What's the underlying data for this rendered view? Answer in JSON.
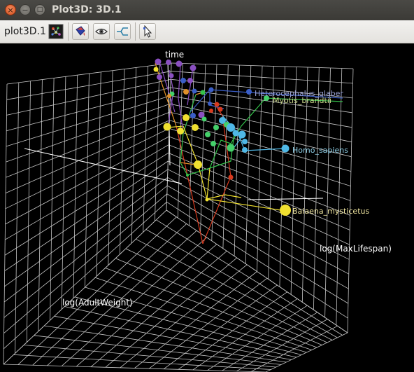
{
  "window": {
    "title": "Plot3D: 3D.1"
  },
  "titlebar": {
    "close_glyph": "×",
    "minimize_glyph": "−",
    "maximize_glyph": "□"
  },
  "toolbar": {
    "plot_name": "plot3D.1",
    "buttons": [
      {
        "icon": "plot-thumbnail-icon"
      },
      {
        "icon": "color-bucket-icon"
      },
      {
        "icon": "eye-icon"
      },
      {
        "icon": "tree-branch-icon"
      },
      {
        "icon": "pointer-cursor-icon"
      }
    ]
  },
  "plot": {
    "axis_labels": {
      "time": "time",
      "max_lifespan": "log(MaxLifespan)",
      "adult_weight": "log(AdultWeight)"
    },
    "tip_labels": [
      {
        "name": "Heterocephalus_glaber",
        "color": "#9aa2d6"
      },
      {
        "name": "Myotis_brandtii",
        "color": "#c8d48a"
      },
      {
        "name": "Homo_sapiens",
        "color": "#8fd0e8"
      },
      {
        "name": "Balaena_mysticetus",
        "color": "#f0e6a0"
      }
    ]
  },
  "colors": {
    "grid": "#dcdcdc",
    "background": "#000000",
    "axis_label": "#ffffff",
    "red_branch": "#d83a1e",
    "green_branch": "#33c24a",
    "yellow_branch": "#f0e030",
    "purple_branch": "#8a4fc0",
    "blue_branch": "#3a5ec8",
    "cyan_branch": "#4fb8e6",
    "orange_branch": "#e0902a"
  }
}
